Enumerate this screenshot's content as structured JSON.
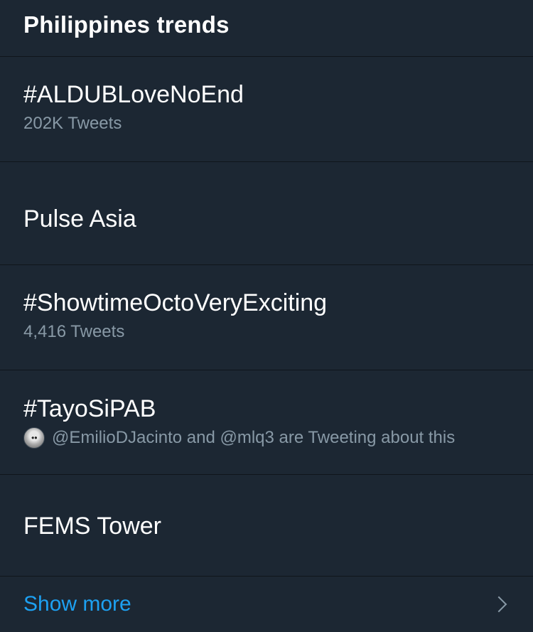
{
  "header": {
    "title": "Philippines trends"
  },
  "trends": [
    {
      "name": "#ALDUBLoveNoEnd",
      "meta": "202K Tweets"
    },
    {
      "name": "Pulse Asia"
    },
    {
      "name": "#ShowtimeOctoVeryExciting",
      "meta": "4,416 Tweets"
    },
    {
      "name": "#TayoSiPAB",
      "meta": "@EmilioDJacinto and @mlq3 are Tweeting about this",
      "avatar": "user-avatar"
    },
    {
      "name": "FEMS Tower"
    }
  ],
  "footer": {
    "show_more_label": "Show more",
    "chevron_icon": "chevron-right-icon"
  },
  "colors": {
    "background": "#1c2733",
    "divider": "#0f151b",
    "primary_text": "#ffffff",
    "secondary_text": "#8899a6",
    "link": "#1da1f2"
  }
}
